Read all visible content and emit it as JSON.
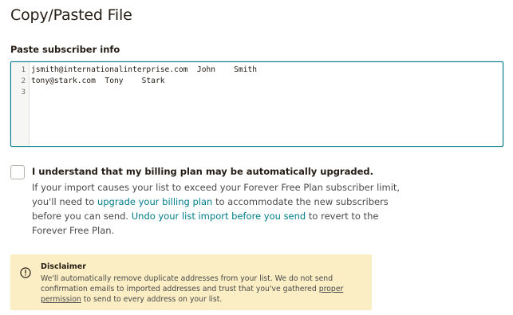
{
  "title": "Copy/Pasted File",
  "paste": {
    "label": "Paste subscriber info",
    "lines": [
      {
        "num": "1",
        "text": "jsmith@internationalinterprise.com  John    Smith"
      },
      {
        "num": "2",
        "text": "tony@stark.com  Tony    Stark"
      },
      {
        "num": "3",
        "text": ""
      }
    ]
  },
  "billing": {
    "checkbox_label": "I understand that my billing plan may be automatically upgraded.",
    "checked": false,
    "line1": "If your import causes your list to exceed your Forever Free Plan subscriber limit,",
    "line2_pre": "you'll need to ",
    "line2_link": "upgrade your billing plan",
    "line2_post": " to accommodate the new subscribers",
    "line3_pre": "before you can send. ",
    "line3_link": "Undo your list import before you send",
    "line3_post": " to revert to the",
    "line4": "Forever Free Plan."
  },
  "disclaimer": {
    "icon": "exclamation-circle-icon",
    "title": "Disclaimer",
    "line1": "We'll automatically remove duplicate addresses from your list. We do not send",
    "line2_pre": "confirmation emails to imported addresses and trust that you've gathered ",
    "line2_link": "proper",
    "line3_link": "permission",
    "line3_post": " to send to every address on your list."
  },
  "colors": {
    "accent": "#007c89",
    "warning_bg": "#fbeec4",
    "text": "#241c15"
  }
}
